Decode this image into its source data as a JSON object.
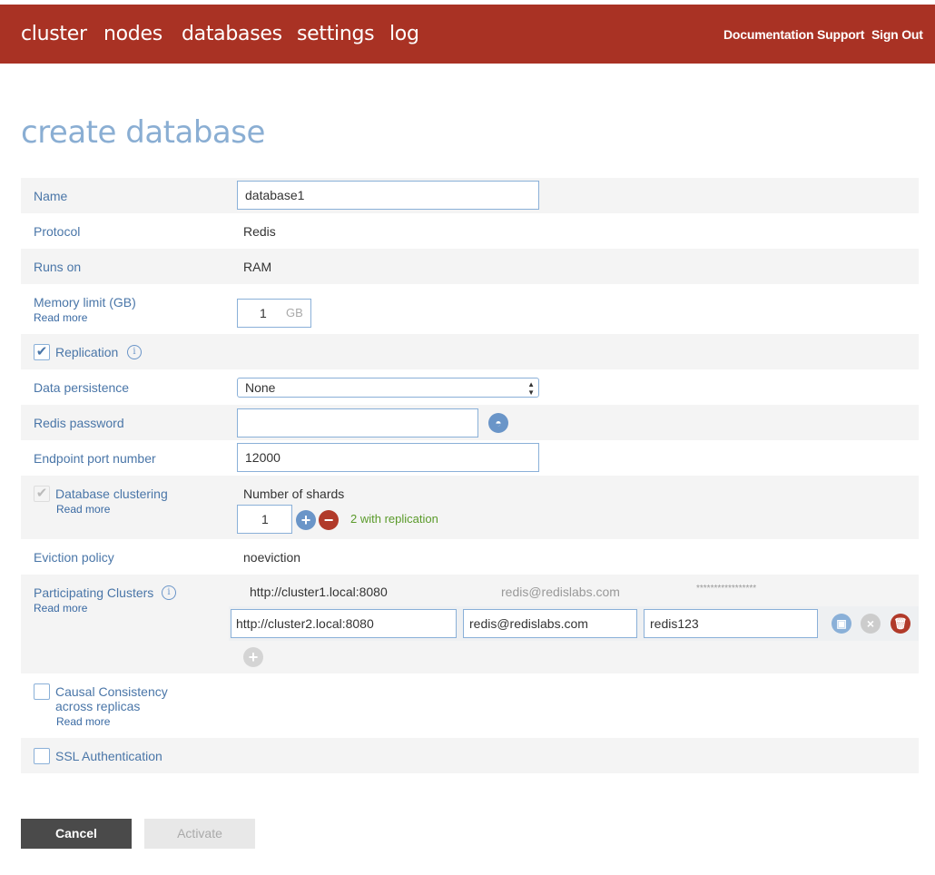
{
  "nav": {
    "items": [
      "cluster",
      "nodes",
      "databases",
      "settings",
      "log"
    ],
    "links": [
      "Documentation",
      "Support",
      "Sign Out"
    ]
  },
  "page": {
    "title": "create database"
  },
  "form": {
    "name": {
      "label": "Name",
      "value": "database1"
    },
    "protocol": {
      "label": "Protocol",
      "value": "Redis"
    },
    "runs_on": {
      "label": "Runs on",
      "value": "RAM"
    },
    "memory": {
      "label": "Memory limit (GB)",
      "read_more": "Read more",
      "value": "1",
      "unit": "GB"
    },
    "replication": {
      "label": "Replication",
      "checked": true
    },
    "persistence": {
      "label": "Data persistence",
      "value": "None"
    },
    "password": {
      "label": "Redis password",
      "value": ""
    },
    "port": {
      "label": "Endpoint port number",
      "value": "12000"
    },
    "clustering": {
      "label": "Database clustering",
      "read_more": "Read more",
      "shards_label": "Number of shards",
      "shards_value": "1",
      "replication_note": "2 with replication"
    },
    "eviction": {
      "label": "Eviction policy",
      "value": "noeviction"
    },
    "participating": {
      "label": "Participating Clusters",
      "read_more": "Read more",
      "existing": {
        "url": "http://cluster1.local:8080",
        "email": "redis@redislabs.com",
        "password": "*****************"
      },
      "editing": {
        "url": "http://cluster2.local:8080",
        "email": "redis@redislabs.com",
        "password": "redis123"
      }
    },
    "causal": {
      "label_line1": "Causal Consistency",
      "label_line2": "across replicas",
      "read_more": "Read more"
    },
    "ssl": {
      "label": "SSL Authentication"
    }
  },
  "buttons": {
    "cancel": "Cancel",
    "activate": "Activate"
  },
  "colors": {
    "topbar": "#a93224",
    "accent": "#4a76a8",
    "title": "#8aaed3",
    "green": "#5a9a2a"
  }
}
